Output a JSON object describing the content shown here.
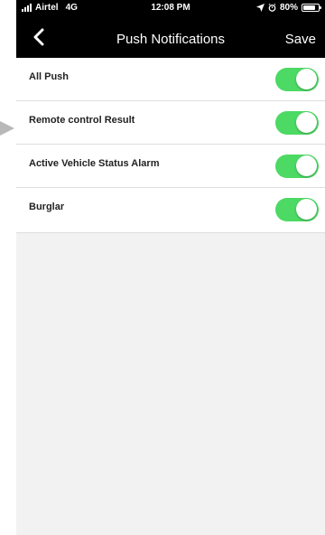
{
  "status_bar": {
    "carrier": "Airtel",
    "network": "4G",
    "time": "12:08 PM",
    "battery": "80%",
    "battery_level": 0.8
  },
  "nav": {
    "back_icon": "chevron-left-icon",
    "title": "Push Notifications",
    "save_label": "Save"
  },
  "settings": [
    {
      "label": "All Push",
      "enabled": true
    },
    {
      "label": "Remote control Result",
      "enabled": true
    },
    {
      "label": "Active Vehicle Status Alarm",
      "enabled": true
    },
    {
      "label": "Burglar",
      "enabled": true
    }
  ],
  "colors": {
    "toggle_on": "#4cd964",
    "bar_background": "#000000",
    "page_background": "#f2f2f2",
    "pointer_arrow": "#b8b8b8"
  }
}
